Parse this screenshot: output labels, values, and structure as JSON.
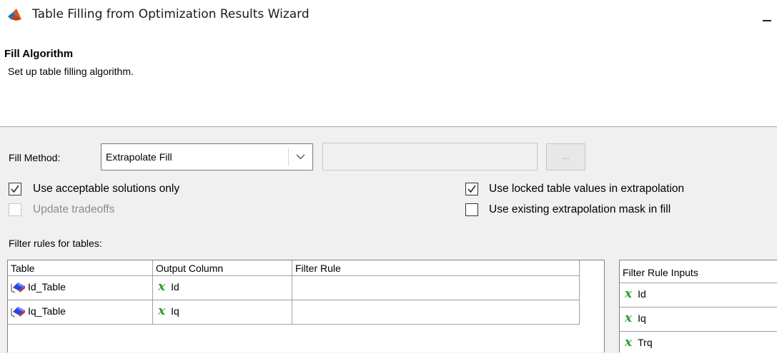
{
  "window": {
    "title": "Table Filling from Optimization Results Wizard"
  },
  "page": {
    "heading": "Fill Algorithm",
    "subtitle": "Set up table filling algorithm."
  },
  "fill": {
    "method_label": "Fill Method:",
    "method_value": "Extrapolate Fill",
    "ellipsis_label": "...",
    "use_acceptable_label": "Use acceptable solutions only",
    "use_acceptable_checked": true,
    "update_tradeoffs_label": "Update tradeoffs",
    "update_tradeoffs_checked": false,
    "use_locked_label": "Use locked table values in extrapolation",
    "use_locked_checked": true,
    "use_existing_mask_label": "Use existing extrapolation mask in fill",
    "use_existing_mask_checked": false
  },
  "filter_rules": {
    "label": "Filter rules for tables:",
    "columns": [
      "Table",
      "Output Column",
      "Filter Rule"
    ],
    "rows": [
      {
        "table": "Id_Table",
        "output": "Id",
        "rule": ""
      },
      {
        "table": "Iq_Table",
        "output": "Iq",
        "rule": ""
      }
    ]
  },
  "filter_inputs": {
    "header": "Filter Rule Inputs",
    "items": [
      "Id",
      "Iq",
      "Trq"
    ]
  },
  "icons": {
    "app": "matlab-icon",
    "table": "table-lookup-icon",
    "variable": "x-variable-icon"
  },
  "colors": {
    "variable_icon": "#2e9e2e",
    "panel_bg": "#f0f0f0"
  }
}
